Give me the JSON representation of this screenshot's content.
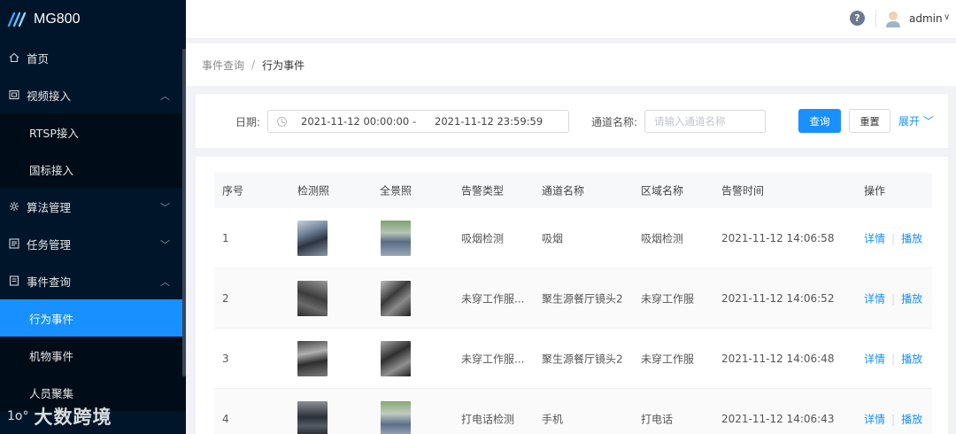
{
  "app": {
    "name": "MG800"
  },
  "sidebar": {
    "home": {
      "label": "首页",
      "icon": "home-icon"
    },
    "video": {
      "label": "视频接入",
      "icon": "video-icon",
      "children": [
        "RTSP接入",
        "国标接入"
      ]
    },
    "algo": {
      "label": "算法管理",
      "icon": "algorithm-icon"
    },
    "task": {
      "label": "任务管理",
      "icon": "task-icon"
    },
    "event": {
      "label": "事件查询",
      "icon": "event-icon",
      "children": [
        "行为事件",
        "机物事件",
        "人员聚集"
      ],
      "active": "行为事件"
    }
  },
  "header": {
    "user": "admin",
    "help_icon": "help-icon"
  },
  "breadcrumb": {
    "parent": "事件查询",
    "separator": "/",
    "current": "行为事件"
  },
  "filter": {
    "date_label": "日期:",
    "date_start": "2021-11-12 00:00:00",
    "date_sep": "-",
    "date_end": "2021-11-12 23:59:59",
    "channel_label": "通道名称:",
    "channel_placeholder": "请输入通道名称",
    "query_btn": "查询",
    "reset_btn": "重置",
    "expand": "展开"
  },
  "table": {
    "headers": [
      "序号",
      "检测照",
      "全景照",
      "告警类型",
      "通道名称",
      "区域名称",
      "告警时间",
      "操作"
    ],
    "rows": [
      {
        "no": "1",
        "type": "吸烟检测",
        "channel": "吸烟",
        "area": "吸烟检测",
        "time": "2021-11-12 14:06:58"
      },
      {
        "no": "2",
        "type": "未穿工作服...",
        "channel": "聚生源餐厅镜头2",
        "area": "未穿工作服",
        "time": "2021-11-12 14:06:52"
      },
      {
        "no": "3",
        "type": "未穿工作服...",
        "channel": "聚生源餐厅镜头2",
        "area": "未穿工作服",
        "time": "2021-11-12 14:06:48"
      },
      {
        "no": "4",
        "type": "打电话检测",
        "channel": "手机",
        "area": "打电话",
        "time": "2021-11-12 14:06:43"
      }
    ],
    "op_detail": "详情",
    "op_play": "播放"
  },
  "watermark": {
    "mark": "1o°",
    "text": "大数跨境"
  },
  "colors": {
    "sidebar": "#001529",
    "submenu": "#000c17",
    "accent": "#1890ff"
  }
}
